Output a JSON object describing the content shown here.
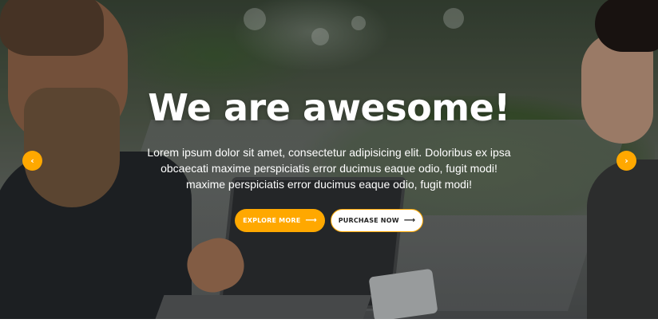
{
  "hero": {
    "headline": "We are awesome!",
    "subtext_lines": [
      "Lorem ipsum dolor sit amet, consectetur adipisicing elit. Doloribus ex ipsa",
      "obcaecati maxime perspiciatis error ducimus eaque odio, fugit modi!",
      "maxime perspiciatis error ducimus eaque odio, fugit modi!"
    ],
    "buttons": {
      "explore_label": "EXPLORE MORE",
      "purchase_label": "PURCHASE NOW",
      "arrow_icon": "arrow-right-icon",
      "arrow_glyph": "⟶"
    }
  },
  "slider": {
    "prev_icon": "chevron-left-icon",
    "prev_glyph": "‹",
    "next_icon": "chevron-right-icon",
    "next_glyph": "›"
  },
  "colors": {
    "accent": "#ffa800",
    "text": "#ffffff",
    "button_outline_text": "#222222"
  }
}
